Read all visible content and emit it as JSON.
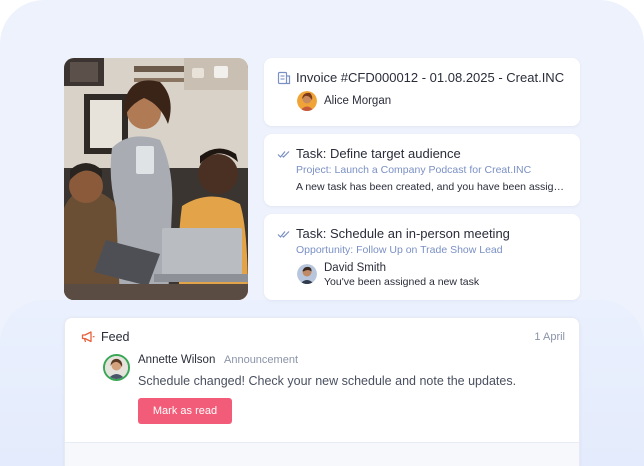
{
  "colors": {
    "background_accent": "#eef2fc",
    "subtitle_blue": "#7a90c4",
    "primary_button": "#f25c78",
    "feed_icon": "#e8603c",
    "avatar_ring": "#3aa757"
  },
  "photo": {
    "icon": "team-office-photo"
  },
  "cards": [
    {
      "icon": "invoice-document-icon",
      "title": "Invoice #CFD000012 - 01.08.2025 - Creat.INC",
      "person": "Alice Morgan"
    },
    {
      "icon": "double-check-icon",
      "title": "Task: Define target audience",
      "subtitle": "Project: Launch a Company Podcast for Creat.INC",
      "description": "A new task has been created, and you have been assigned to it"
    },
    {
      "icon": "double-check-icon",
      "title": "Task: Schedule an in-person meeting",
      "subtitle": "Opportunity: Follow Up on Trade Show Lead",
      "person": "David Smith",
      "person_note": "You've been assigned a new task"
    }
  ],
  "feed": {
    "icon": "megaphone-icon",
    "title": "Feed",
    "date": "1 April",
    "post": {
      "author": "Annette Wilson",
      "tag": "Announcement",
      "message": "Schedule changed! Check your new schedule and note the updates.",
      "action_label": "Mark as read"
    }
  }
}
